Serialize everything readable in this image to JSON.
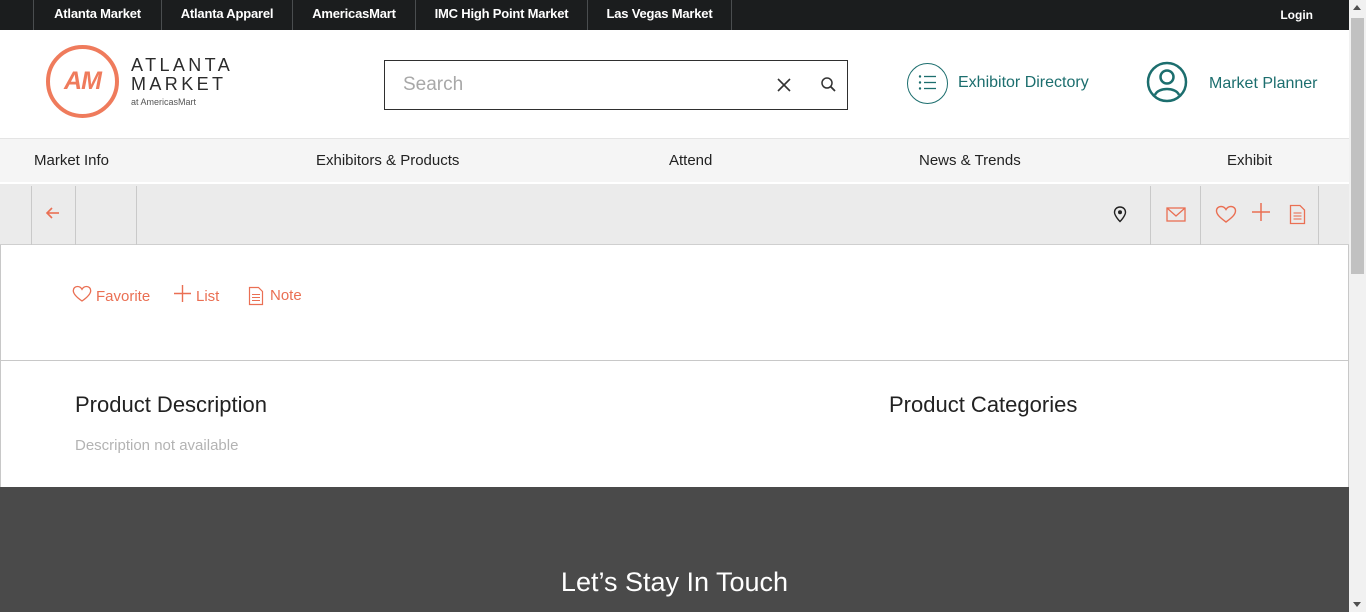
{
  "topbar": {
    "markets": [
      "Atlanta Market",
      "Atlanta Apparel",
      "AmericasMart",
      "IMC High Point Market",
      "Las Vegas Market"
    ],
    "login": "Login"
  },
  "header": {
    "logo": {
      "mark": "AM",
      "line1": "ATLANTA",
      "line2": "MARKET",
      "sub": "at AmericasMart"
    },
    "search": {
      "placeholder": "Search"
    },
    "exhibitor_directory": "Exhibitor Directory",
    "market_planner": "Market Planner"
  },
  "nav": {
    "items": [
      "Market Info",
      "Exhibitors & Products",
      "Attend",
      "News & Trends",
      "Exhibit"
    ]
  },
  "product_actions": {
    "favorite": "Favorite",
    "list": "List",
    "note": "Note"
  },
  "product": {
    "description_heading": "Product Description",
    "description_text": "Description not available",
    "categories_heading": "Product Categories"
  },
  "footer": {
    "title": "Let’s Stay In Touch"
  },
  "colors": {
    "accent": "#ea6f53",
    "teal": "#1c6e6e",
    "topbar": "#1b1d1e",
    "footer": "#4a4a4a"
  }
}
